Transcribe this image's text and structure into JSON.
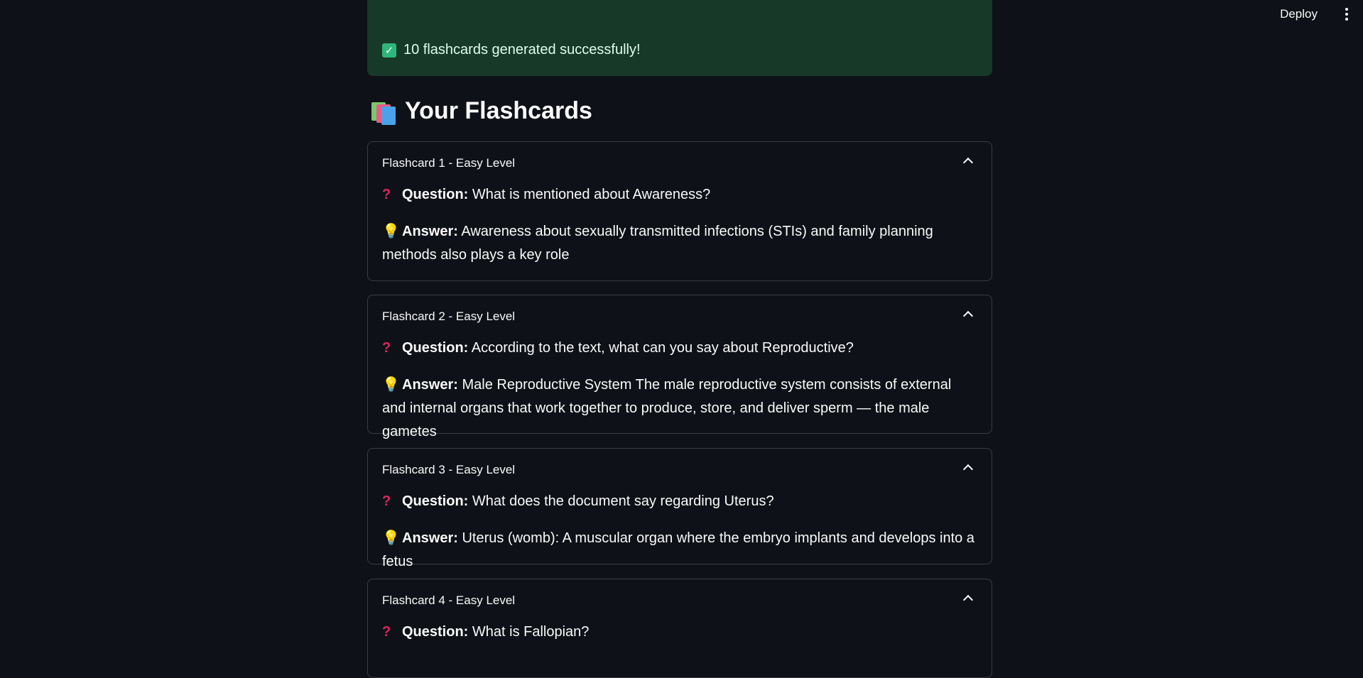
{
  "header": {
    "deploy_label": "Deploy",
    "menu_icon": "kebab-menu-icon"
  },
  "alert": {
    "icon": "check-icon",
    "text": "10 flashcards generated successfully!",
    "color": "#173928"
  },
  "section": {
    "icon": "books-icon",
    "title": "Your Flashcards"
  },
  "labels": {
    "question": "Question:",
    "answer": "Answer:"
  },
  "flashcards": [
    {
      "title": "Flashcard 1 - Easy Level",
      "question": "What is mentioned about Awareness?",
      "answer": "Awareness about sexually transmitted infections (STIs) and family planning methods also plays a key role"
    },
    {
      "title": "Flashcard 2 - Easy Level",
      "question": "According to the text, what can you say about Reproductive?",
      "answer": "Male Reproductive System The male reproductive system consists of external and internal organs that work together to produce, store, and deliver sperm — the male gametes"
    },
    {
      "title": "Flashcard 3 - Easy Level",
      "question": "What does the document say regarding Uterus?",
      "answer": "Uterus (womb): A muscular organ where the embryo implants and develops into a fetus"
    },
    {
      "title": "Flashcard 4 - Easy Level",
      "question": "What is Fallopian?",
      "answer": ""
    }
  ]
}
